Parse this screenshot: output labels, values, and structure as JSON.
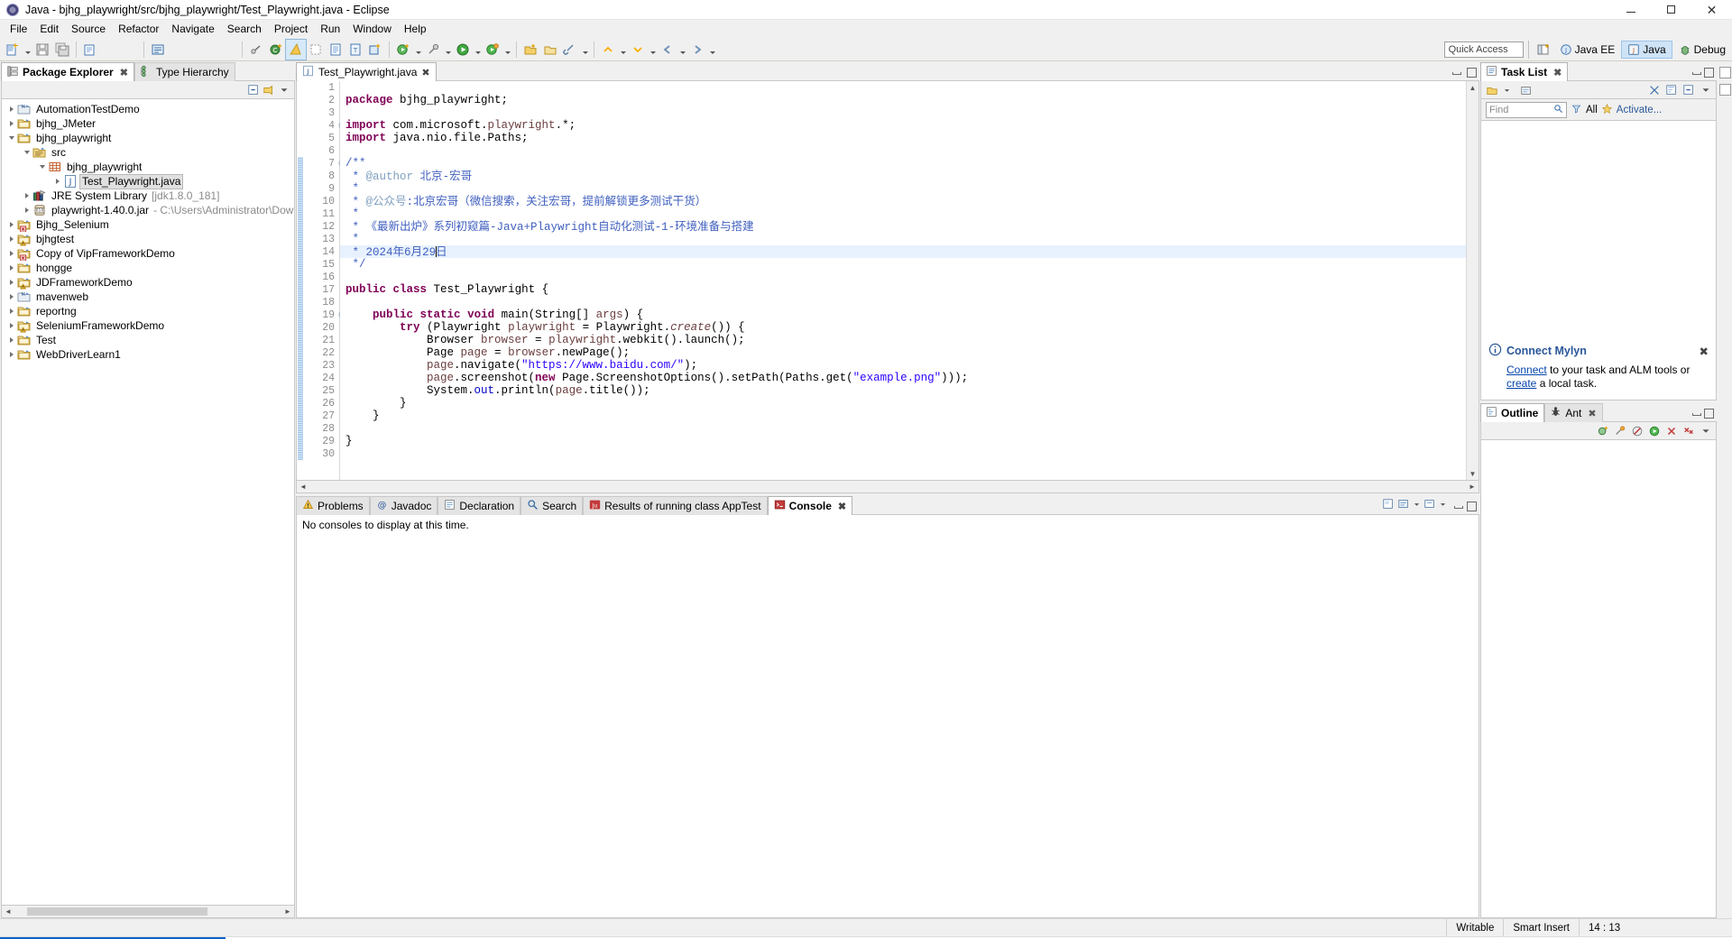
{
  "window": {
    "title": "Java - bjhg_playwright/src/bjhg_playwright/Test_Playwright.java - Eclipse",
    "icon": "eclipse-icon",
    "minimize": "–",
    "maximize": "□",
    "close": "✕"
  },
  "menu": [
    "File",
    "Edit",
    "Source",
    "Refactor",
    "Navigate",
    "Search",
    "Project",
    "Run",
    "Window",
    "Help"
  ],
  "toolbar": {
    "quick_access_placeholder": "Quick Access",
    "perspectives": [
      {
        "label": "Java EE",
        "icon": "javaee-perspective-icon",
        "active": false
      },
      {
        "label": "Java",
        "icon": "java-perspective-icon",
        "active": true
      },
      {
        "label": "Debug",
        "icon": "debug-perspective-icon",
        "active": false
      }
    ]
  },
  "package_explorer": {
    "tabs": [
      {
        "label": "Package Explorer",
        "icon": "package-explorer-icon",
        "active": true,
        "close": "✖"
      },
      {
        "label": "Type Hierarchy",
        "icon": "type-hierarchy-icon",
        "active": false
      }
    ],
    "view_actions": [
      "collapse-all-icon",
      "link-with-editor-icon",
      "view-menu-icon"
    ],
    "tree": [
      {
        "label": "AutomationTestDemo",
        "indent": 0,
        "state": "collapsed",
        "icon": "project-maven-icon"
      },
      {
        "label": "bjhg_JMeter",
        "indent": 0,
        "state": "collapsed",
        "icon": "project-folder-icon"
      },
      {
        "label": "bjhg_playwright",
        "indent": 0,
        "state": "open",
        "icon": "project-folder-icon"
      },
      {
        "label": "src",
        "indent": 1,
        "state": "open",
        "icon": "source-folder-icon"
      },
      {
        "label": "bjhg_playwright",
        "indent": 2,
        "state": "open",
        "icon": "package-icon"
      },
      {
        "label": "Test_Playwright.java",
        "indent": 3,
        "state": "collapsed",
        "icon": "java-file-icon",
        "selected": true
      },
      {
        "label": "JRE System Library",
        "sub": "[jdk1.8.0_181]",
        "indent": 1,
        "state": "collapsed",
        "icon": "library-icon"
      },
      {
        "label": "playwright-1.40.0.jar",
        "sub": "- C:\\Users\\Administrator\\Downloads",
        "indent": 1,
        "state": "collapsed",
        "icon": "jar-icon"
      },
      {
        "label": "Bjhg_Selenium",
        "indent": 0,
        "state": "collapsed",
        "icon": "project-error-icon"
      },
      {
        "label": "bjhgtest",
        "indent": 0,
        "state": "collapsed",
        "icon": "project-warning-icon"
      },
      {
        "label": "Copy of VipFrameworkDemo",
        "indent": 0,
        "state": "collapsed",
        "icon": "project-error-icon"
      },
      {
        "label": "hongge",
        "indent": 0,
        "state": "collapsed",
        "icon": "project-folder-icon"
      },
      {
        "label": "JDFrameworkDemo",
        "indent": 0,
        "state": "collapsed",
        "icon": "project-warning-icon"
      },
      {
        "label": "mavenweb",
        "indent": 0,
        "state": "collapsed",
        "icon": "project-maven-icon"
      },
      {
        "label": "reportng",
        "indent": 0,
        "state": "collapsed",
        "icon": "project-folder-icon"
      },
      {
        "label": "SeleniumFrameworkDemo",
        "indent": 0,
        "state": "collapsed",
        "icon": "project-warning-icon"
      },
      {
        "label": "Test",
        "indent": 0,
        "state": "collapsed",
        "icon": "project-folder-icon"
      },
      {
        "label": "WebDriverLearn1",
        "indent": 0,
        "state": "collapsed",
        "icon": "project-folder-icon"
      }
    ]
  },
  "editor": {
    "tab": {
      "label": "Test_Playwright.java",
      "icon": "java-file-icon",
      "close": "✖"
    },
    "lines": [
      {
        "n": 1,
        "text": "",
        "fold": false
      },
      {
        "n": 2,
        "text": "package bjhg_playwright;",
        "fold": false
      },
      {
        "n": 3,
        "text": "",
        "fold": false
      },
      {
        "n": 4,
        "text": "import com.microsoft.playwright.*;",
        "fold": true
      },
      {
        "n": 5,
        "text": "import java.nio.file.Paths;",
        "fold": false
      },
      {
        "n": 6,
        "text": "",
        "fold": false
      },
      {
        "n": 7,
        "text": "/**",
        "fold": true
      },
      {
        "n": 8,
        "text": " * @author 北京-宏哥",
        "fold": false
      },
      {
        "n": 9,
        "text": " *",
        "fold": false
      },
      {
        "n": 10,
        "text": " * @公众号:北京宏哥（微信搜索，关注宏哥，提前解锁更多测试干货）",
        "fold": false
      },
      {
        "n": 11,
        "text": " *",
        "fold": false
      },
      {
        "n": 12,
        "text": " * 《最新出炉》系列初窥篇-Java+Playwright自动化测试-1-环境准备与搭建",
        "fold": false
      },
      {
        "n": 13,
        "text": " *",
        "fold": false
      },
      {
        "n": 14,
        "text": " * 2024年6月29日",
        "fold": false,
        "highlight": true
      },
      {
        "n": 15,
        "text": " */",
        "fold": false
      },
      {
        "n": 16,
        "text": "",
        "fold": false
      },
      {
        "n": 17,
        "text": "public class Test_Playwright {",
        "fold": false
      },
      {
        "n": 18,
        "text": "",
        "fold": false
      },
      {
        "n": 19,
        "text": "    public static void main(String[] args) {",
        "fold": true
      },
      {
        "n": 20,
        "text": "        try (Playwright playwright = Playwright.create()) {",
        "fold": false
      },
      {
        "n": 21,
        "text": "            Browser browser = playwright.webkit().launch();",
        "fold": false
      },
      {
        "n": 22,
        "text": "            Page page = browser.newPage();",
        "fold": false
      },
      {
        "n": 23,
        "text": "            page.navigate(\"https://www.baidu.com/\");",
        "fold": false
      },
      {
        "n": 24,
        "text": "            page.screenshot(new Page.ScreenshotOptions().setPath(Paths.get(\"example.png\")));",
        "fold": false
      },
      {
        "n": 25,
        "text": "            System.out.println(page.title());",
        "fold": false
      },
      {
        "n": 26,
        "text": "        }",
        "fold": false
      },
      {
        "n": 27,
        "text": "    }",
        "fold": false
      },
      {
        "n": 28,
        "text": "",
        "fold": false
      },
      {
        "n": 29,
        "text": "}",
        "fold": false
      },
      {
        "n": 30,
        "text": "",
        "fold": false
      }
    ]
  },
  "bottom_panel": {
    "tabs": [
      {
        "label": "Problems",
        "icon": "problems-icon",
        "active": false
      },
      {
        "label": "Javadoc",
        "icon": "javadoc-icon",
        "active": false
      },
      {
        "label": "Declaration",
        "icon": "declaration-icon",
        "active": false
      },
      {
        "label": "Search",
        "icon": "search-icon",
        "active": false
      },
      {
        "label": "Results of running class AppTest",
        "icon": "junit-icon",
        "active": false
      },
      {
        "label": "Console",
        "icon": "console-icon",
        "active": true,
        "close": "✖"
      }
    ],
    "console_message": "No consoles to display at this time."
  },
  "task_list": {
    "tab": {
      "label": "Task List",
      "icon": "task-list-icon",
      "close": "✖"
    },
    "find_placeholder": "Find",
    "all_label": "All",
    "activate_label": "Activate...",
    "mylyn": {
      "title": "Connect Mylyn",
      "link_connect": "Connect",
      "text_mid": " to your task and ALM tools or ",
      "link_create": "create",
      "text_end": " a local task."
    }
  },
  "outline_panel": {
    "tabs": [
      {
        "label": "Outline",
        "icon": "outline-icon",
        "active": true
      },
      {
        "label": "Ant",
        "icon": "ant-icon",
        "active": false,
        "close": "✖"
      }
    ]
  },
  "status_bar": {
    "writable": "Writable",
    "insert_mode": "Smart Insert",
    "cursor_position": "14 : 13"
  },
  "colors": {
    "accent": "#2b579a",
    "keyword": "#7f0055",
    "string": "#2a00ff",
    "javadoc": "#3f5fbf",
    "javadoc_tag": "#7f9fbf",
    "field": "#0000c0",
    "local": "#6a3e3e",
    "selection": "#e8f2fe"
  }
}
